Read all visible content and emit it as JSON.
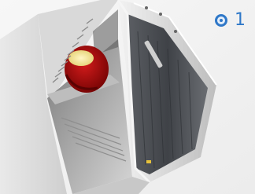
{
  "step": {
    "indicator_icon": "radio-dot-icon",
    "number": "1",
    "accent_color": "#2f78c8"
  },
  "photo": {
    "subject": "appliance-door-open"
  }
}
